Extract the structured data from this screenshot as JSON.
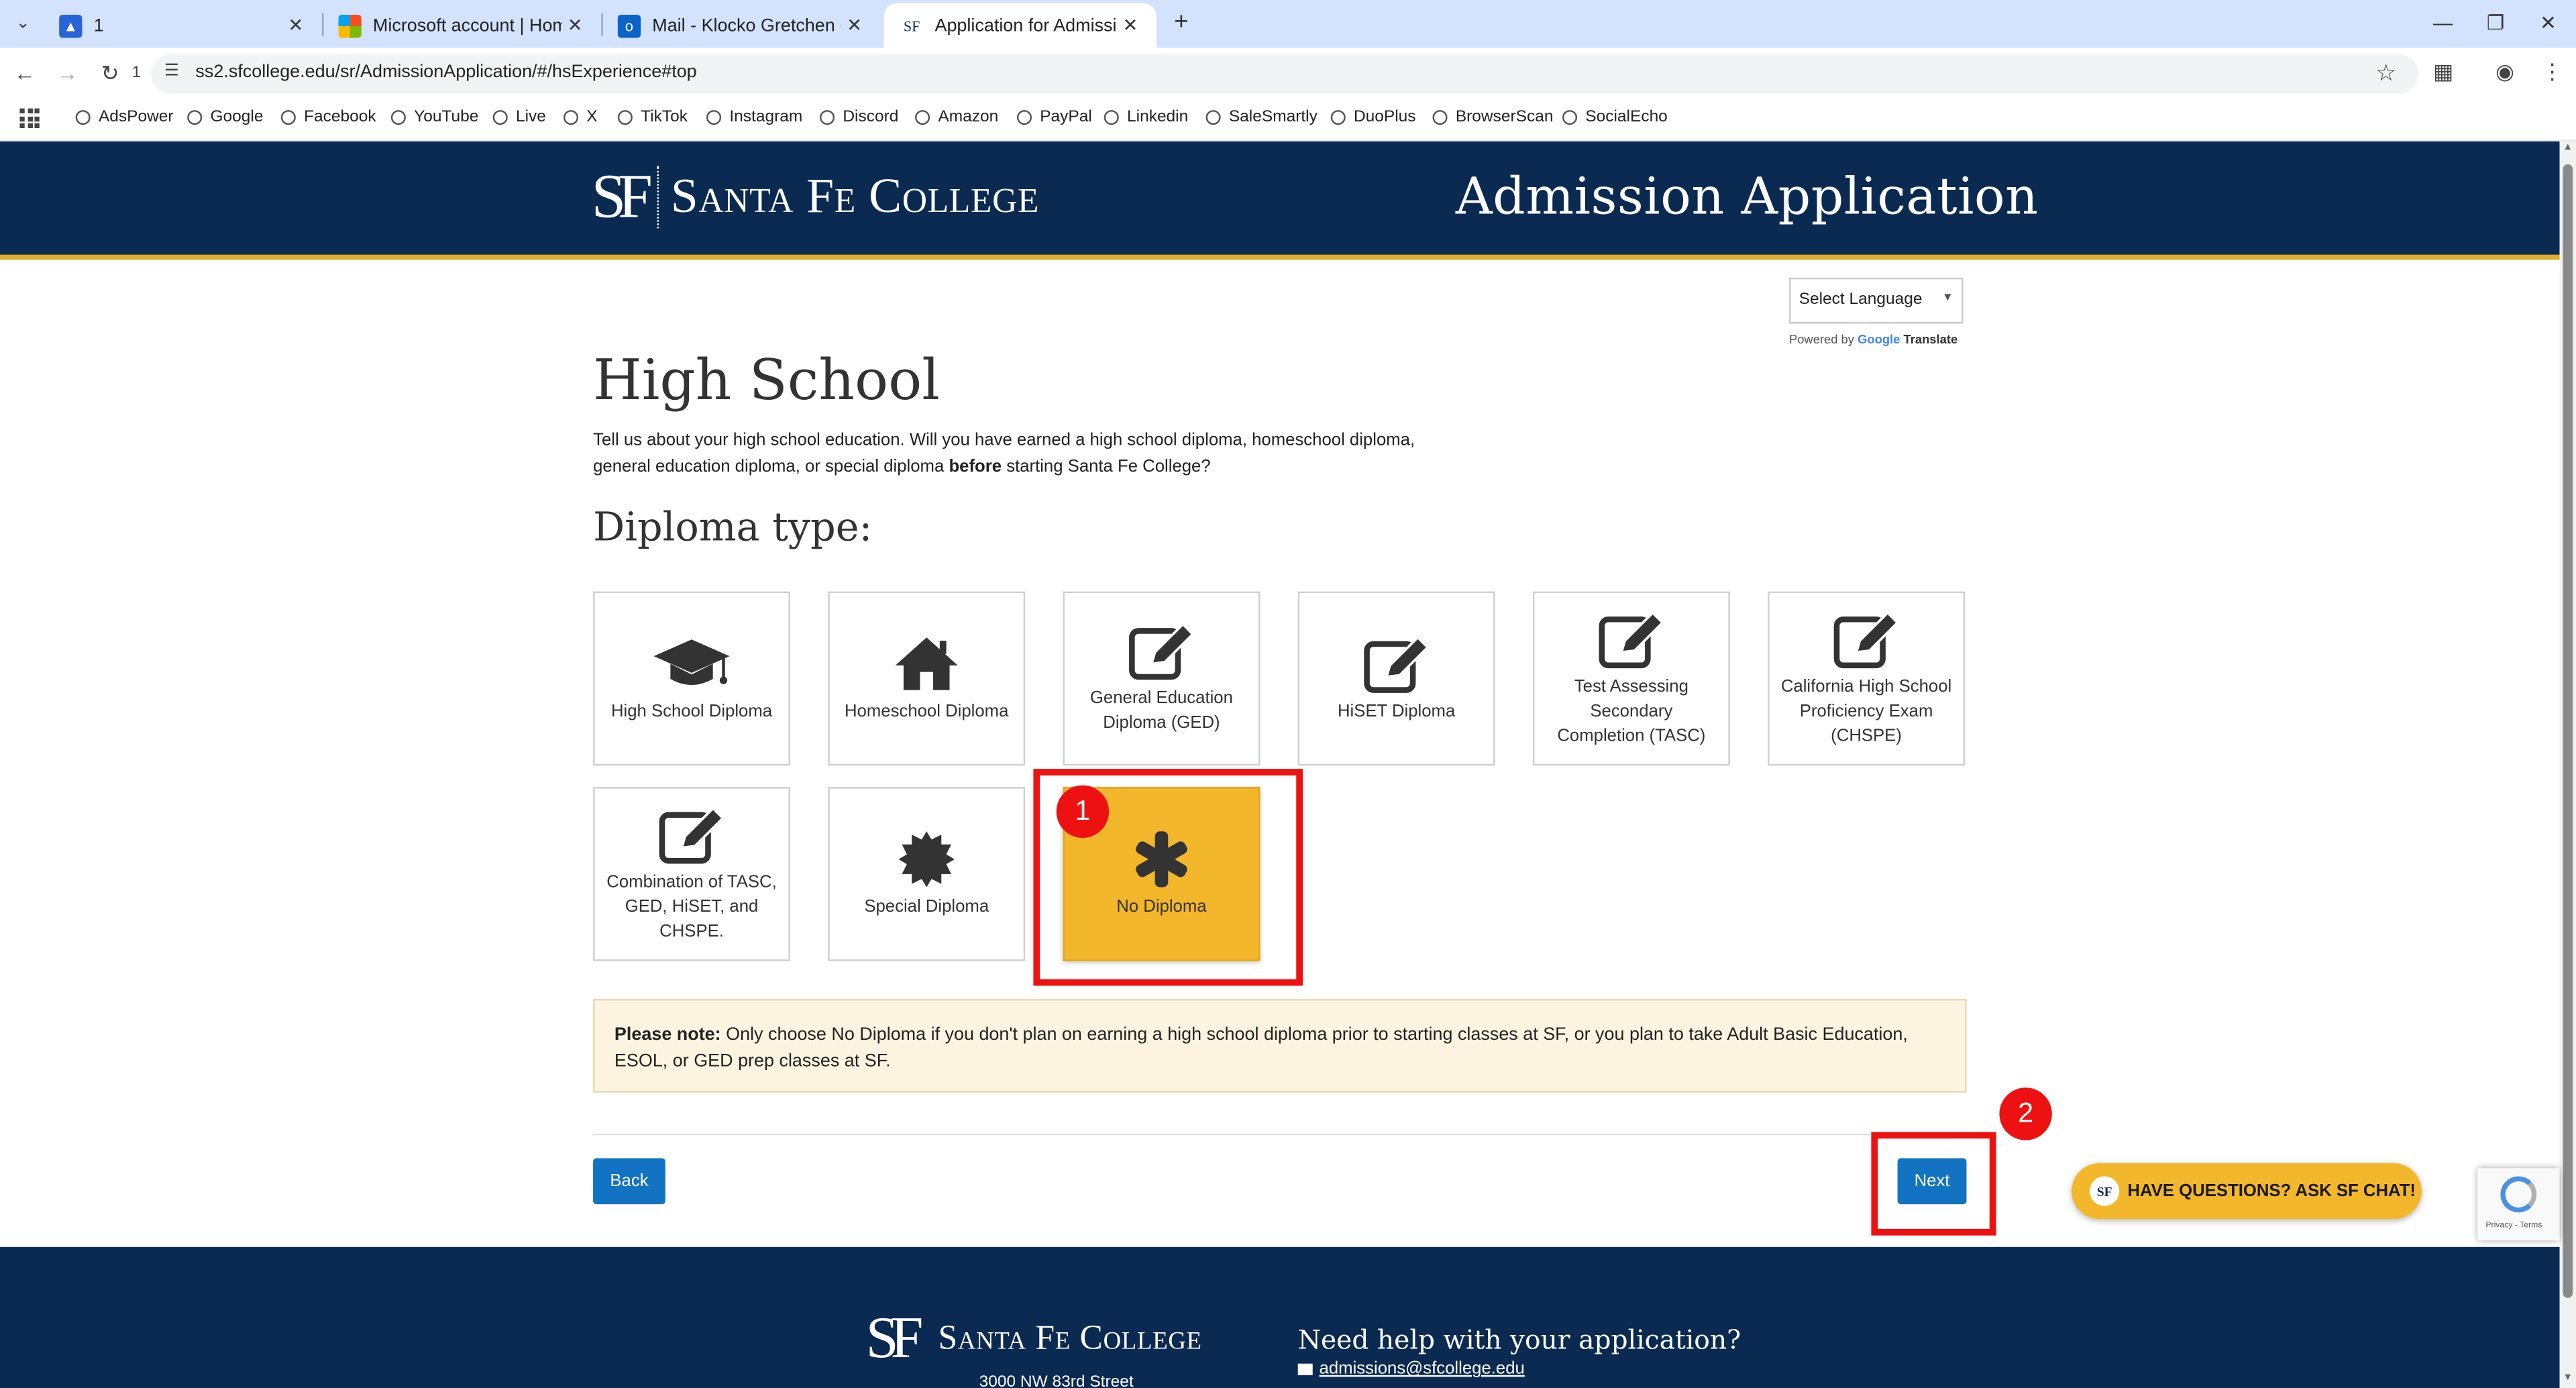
{
  "browser": {
    "tabs": [
      {
        "title": "1"
      },
      {
        "title": "Microsoft account | Home"
      },
      {
        "title": "Mail - Klocko Gretchen - Outlook"
      },
      {
        "title": "Application for Admission"
      }
    ],
    "url": "ss2.sfcollege.edu/sr/AdmissionApplication/#/hsExperience#top",
    "reload_badge": "1",
    "bookmarks": [
      "AdsPower",
      "Google",
      "Facebook",
      "YouTube",
      "Live",
      "X",
      "TikTok",
      "Instagram",
      "Discord",
      "Amazon",
      "PayPal",
      "Linkedin",
      "SaleSmartly",
      "DuoPlus",
      "BrowserScan",
      "SocialEcho"
    ]
  },
  "header": {
    "logo_mono": "SF",
    "logo_name": "Santa Fe College",
    "title": "Admission Application"
  },
  "language": {
    "select_label": "Select Language",
    "powered_by": "Powered by",
    "google": "Google",
    "translate": "Translate"
  },
  "main": {
    "heading": "High School",
    "intro_pre": "Tell us about your high school education. Will you have earned a high school diploma, homeschool diploma, general education diploma, or special diploma ",
    "intro_bold": "before",
    "intro_post": " starting Santa Fe College?",
    "subheading": "Diploma type:",
    "options": [
      {
        "label": "High School Diploma",
        "icon": "graduation-cap-icon"
      },
      {
        "label": "Homeschool Diploma",
        "icon": "house-icon"
      },
      {
        "label": "General Education Diploma (GED)",
        "icon": "edit-icon"
      },
      {
        "label": "HiSET Diploma",
        "icon": "edit-icon"
      },
      {
        "label": "Test Assessing Secondary Completion (TASC)",
        "icon": "edit-icon"
      },
      {
        "label": "California High School Proficiency Exam (CHSPE)",
        "icon": "edit-icon"
      },
      {
        "label": "Combination of TASC, GED, HiSET, and CHSPE.",
        "icon": "edit-icon"
      },
      {
        "label": "Special Diploma",
        "icon": "certificate-icon"
      },
      {
        "label": "No Diploma",
        "icon": "asterisk-icon",
        "selected": true
      }
    ],
    "note_bold": "Please note:",
    "note_text": " Only choose No Diploma if you don't plan on earning a high school diploma prior to starting classes at SF, or you plan to take Adult Basic Education, ESOL, or GED prep classes at SF.",
    "back_label": "Back",
    "next_label": "Next"
  },
  "annotations": [
    "1",
    "2"
  ],
  "footer": {
    "logo_mono": "SF",
    "logo_name": "Santa Fe College",
    "help_title": "Need help with your application?",
    "email": "admissions@sfcollege.edu",
    "address": "3000 NW 83rd Street"
  },
  "chat": {
    "label": "HAVE QUESTIONS? ASK SF CHAT!",
    "badge": "SF"
  },
  "recaptcha": {
    "text": "Privacy - Terms"
  },
  "colors": {
    "navy": "#0b2a52",
    "gold": "#f3b72c",
    "button_blue": "#1173c2",
    "annotation_red": "#ee1111"
  }
}
